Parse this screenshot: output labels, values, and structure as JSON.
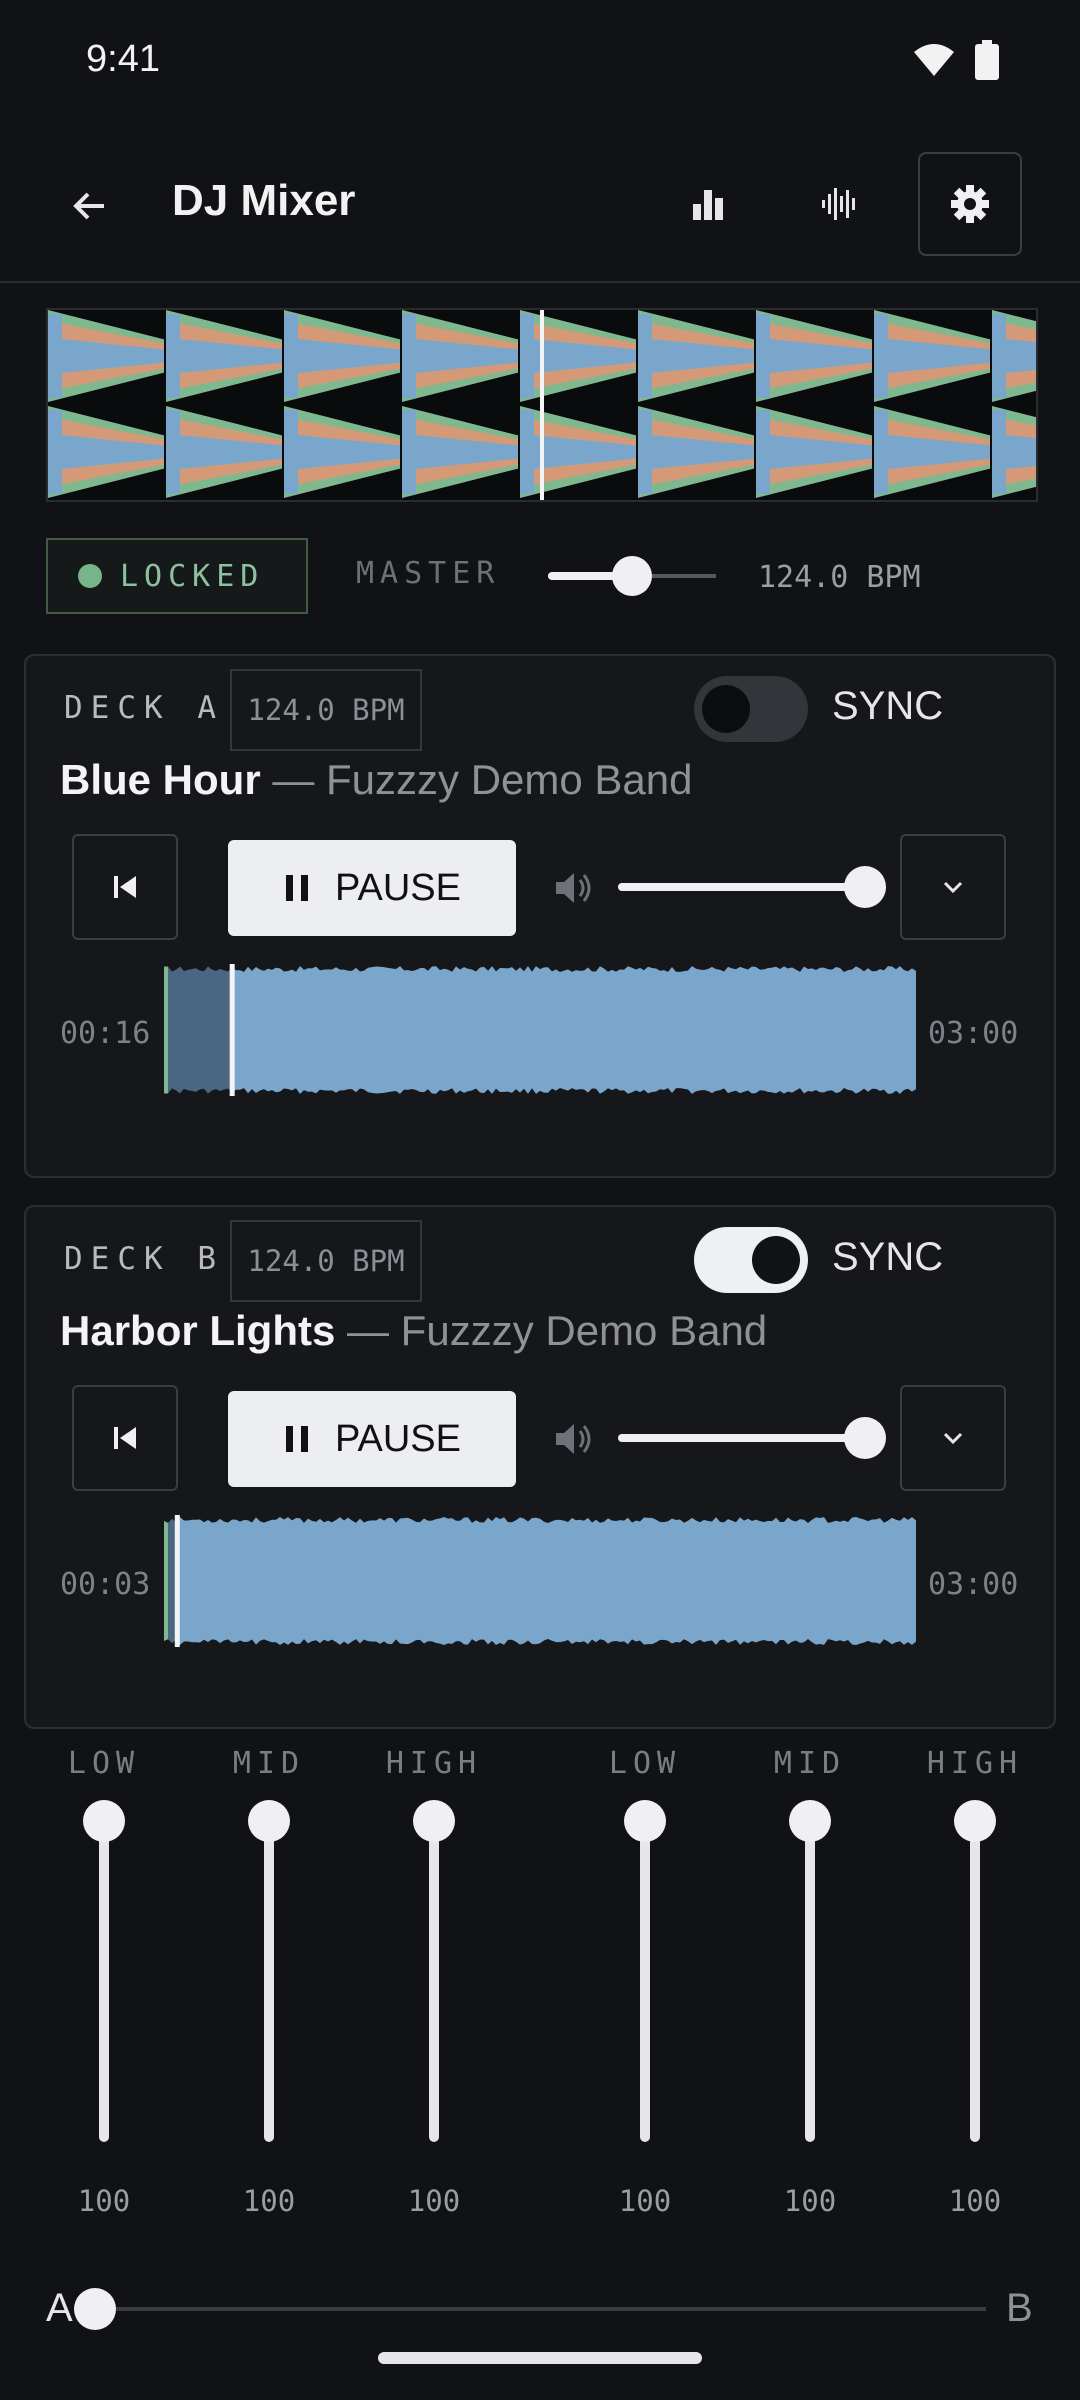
{
  "status": {
    "time": "9:41"
  },
  "app": {
    "title": "DJ Mixer",
    "icons": [
      "back-arrow-icon",
      "bar-chart-icon",
      "waveform-icon",
      "gear-icon"
    ]
  },
  "master": {
    "locked_label": "LOCKED",
    "master_label": "MASTER",
    "bpm": "124.0 BPM",
    "slider_level": 0.5,
    "colors": {
      "locked": "#76b58a"
    }
  },
  "deck_a": {
    "label": "DECK A",
    "bpm": "124.0 BPM",
    "sync_label": "SYNC",
    "sync_on": false,
    "title": "Blue Hour",
    "artist": "— Fuzzzy Demo Band",
    "pause_label": "PAUSE",
    "volume": 1.0,
    "time_elapsed": "00:16",
    "time_total": "03:00",
    "progress": 0.09
  },
  "deck_b": {
    "label": "DECK B",
    "bpm": "124.0 BPM",
    "sync_label": "SYNC",
    "sync_on": true,
    "title": "Harbor Lights",
    "artist": "— Fuzzzy Demo Band",
    "pause_label": "PAUSE",
    "volume": 1.0,
    "time_elapsed": "00:03",
    "time_total": "03:00",
    "progress": 0.017
  },
  "eq": {
    "deck_a": [
      {
        "label": "LOW",
        "value": "100"
      },
      {
        "label": "MID",
        "value": "100"
      },
      {
        "label": "HIGH",
        "value": "100"
      }
    ],
    "deck_b": [
      {
        "label": "LOW",
        "value": "100"
      },
      {
        "label": "MID",
        "value": "100"
      },
      {
        "label": "HIGH",
        "value": "100"
      }
    ]
  },
  "crossfader": {
    "left_label": "A",
    "right_label": "B",
    "position": 0.0
  },
  "colors": {
    "wave_blue": "#7aa6cc",
    "wave_orange": "#d49a78",
    "wave_green": "#7fb88e",
    "background": "#111215"
  }
}
